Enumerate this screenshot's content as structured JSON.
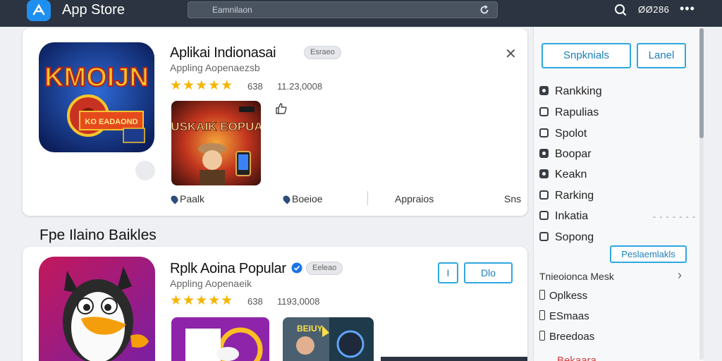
{
  "topbar": {
    "title": "App Store",
    "search_placeholder": "Eamnilaon",
    "count": "ØØ286",
    "more": "•••"
  },
  "card1": {
    "app_name": "Aplikai Indionasai",
    "chip": "Esraeo",
    "subtitle": "Appling Aopenaezsb",
    "rating": "638",
    "downloads": "11.23,0008",
    "icon_text": "KMOIJN",
    "icon_sub": "KO EADAOND",
    "screenshot_text": "BUSKAIK EOPUAS",
    "actions": [
      "Paalk",
      "Boeioe",
      "Appraios",
      "Sns"
    ]
  },
  "section": {
    "title": "Fpe Ilaino Baikles"
  },
  "card2": {
    "app_name": "Rplk Aoina Popular",
    "chip": "Eeleao",
    "subtitle": "Appling Aopenaeik",
    "rating": "638",
    "downloads": "1193,0008",
    "btn_small": "I",
    "btn_get": "Dlo",
    "shot2_text": "BEIUY"
  },
  "sidebar": {
    "btn_primary": "Snpknials",
    "btn_secondary": "Lanel",
    "items": [
      "Rankking",
      "Rapulias",
      "Spolot",
      "Boopar",
      "Keakn",
      "Rarking",
      "Inkatia",
      "Sopong"
    ],
    "promo_button": "Peslaemlakls",
    "submenu_title": "Tnieoionca Mesk",
    "small_items": [
      "Oplkess",
      "ESmaas",
      "Breedoas"
    ],
    "red_item": "Bekaara"
  },
  "colors": {
    "topbar": "#2b3440",
    "accent": "#2ea8e0",
    "star": "#f4b400"
  }
}
